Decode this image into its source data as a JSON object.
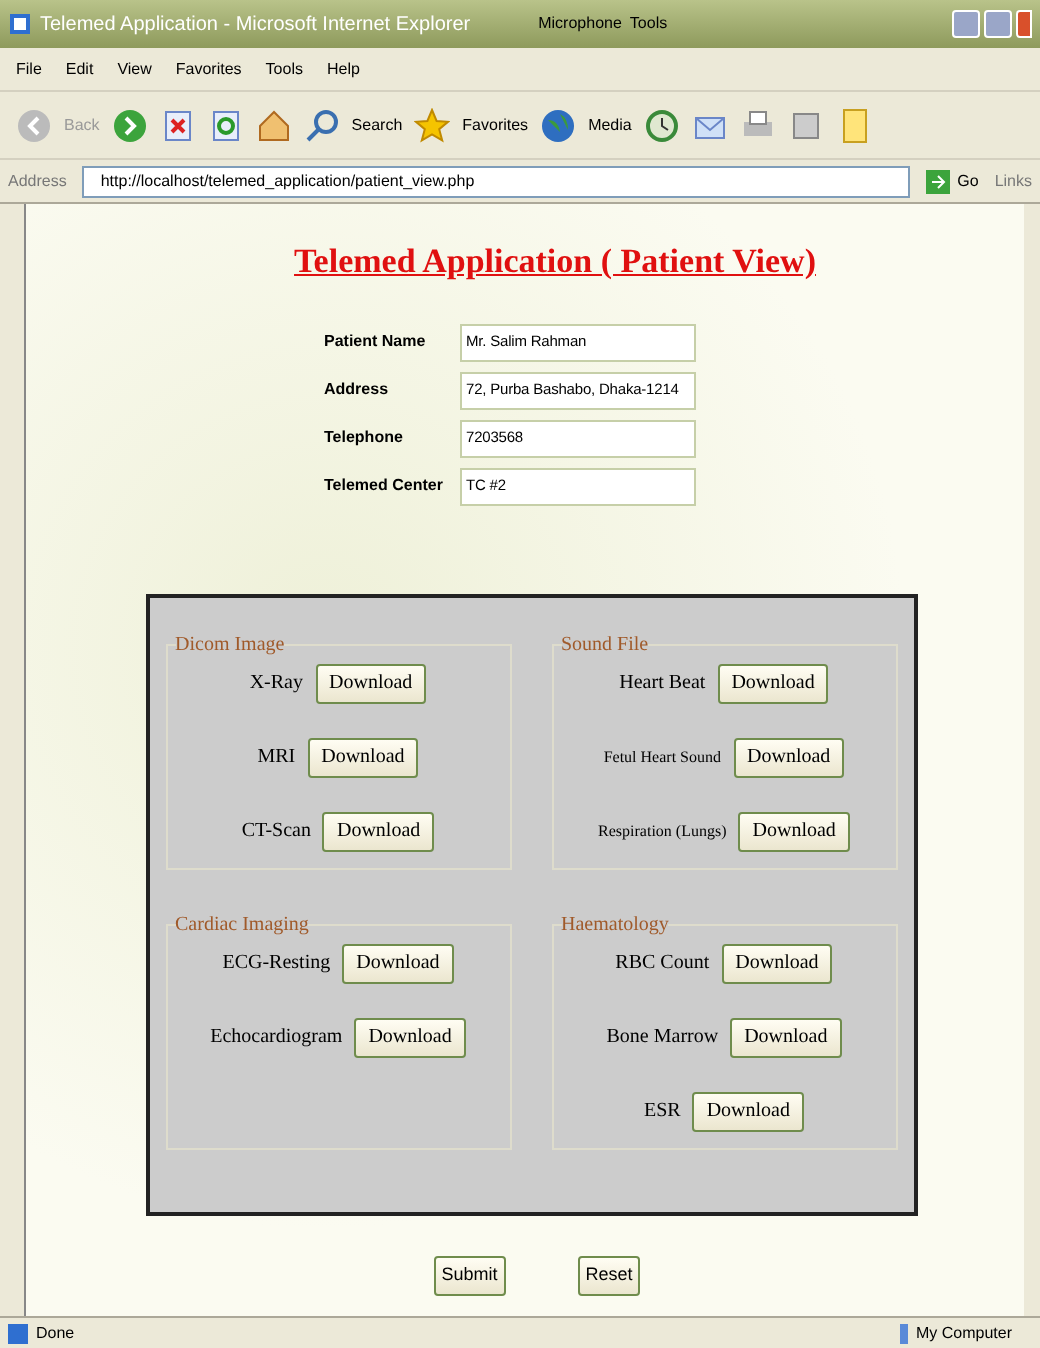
{
  "window": {
    "title": "Telemed Application - Microsoft Internet Explorer",
    "taskbar_items": [
      "Microphone",
      "Tools"
    ]
  },
  "menu": [
    "File",
    "Edit",
    "View",
    "Favorites",
    "Tools",
    "Help"
  ],
  "toolbar": {
    "back": "Back",
    "search": "Search",
    "favorites": "Favorites",
    "media": "Media"
  },
  "address_bar": {
    "label": "Address",
    "url": "http://localhost/telemed_application/patient_view.php",
    "go": "Go",
    "links": "Links"
  },
  "page": {
    "title": "Telemed Application ( Patient View)",
    "fields": [
      {
        "label": "Patient Name",
        "value": "Mr. Salim Rahman"
      },
      {
        "label": "Address",
        "value": "72, Purba Bashabo, Dhaka-1214"
      },
      {
        "label": "Telephone",
        "value": "7203568"
      },
      {
        "label": "Telemed Center",
        "value": "TC #2"
      }
    ],
    "sections": [
      {
        "legend": "Dicom Image",
        "items": [
          {
            "label": "X-Ray",
            "button": "Download"
          },
          {
            "label": "MRI",
            "button": "Download"
          },
          {
            "label": "CT-Scan",
            "button": "Download"
          }
        ]
      },
      {
        "legend": "Sound File",
        "items": [
          {
            "label": "Heart Beat",
            "button": "Download"
          },
          {
            "label": "Fetul Heart Sound",
            "button": "Download",
            "small": true
          },
          {
            "label": "Respiration (Lungs)",
            "button": "Download",
            "small": true
          }
        ]
      },
      {
        "legend": "Cardiac Imaging",
        "items": [
          {
            "label": "ECG-Resting",
            "button": "Download"
          },
          {
            "label": "Echocardiogram",
            "button": "Download"
          }
        ]
      },
      {
        "legend": "Haematology",
        "items": [
          {
            "label": "RBC Count",
            "button": "Download"
          },
          {
            "label": "Bone Marrow",
            "button": "Download"
          },
          {
            "label": "ESR",
            "button": "Download"
          }
        ]
      }
    ],
    "buttons": [
      "Submit",
      "Reset"
    ]
  },
  "status_bar": {
    "status": "Done",
    "zone": "My Computer"
  }
}
